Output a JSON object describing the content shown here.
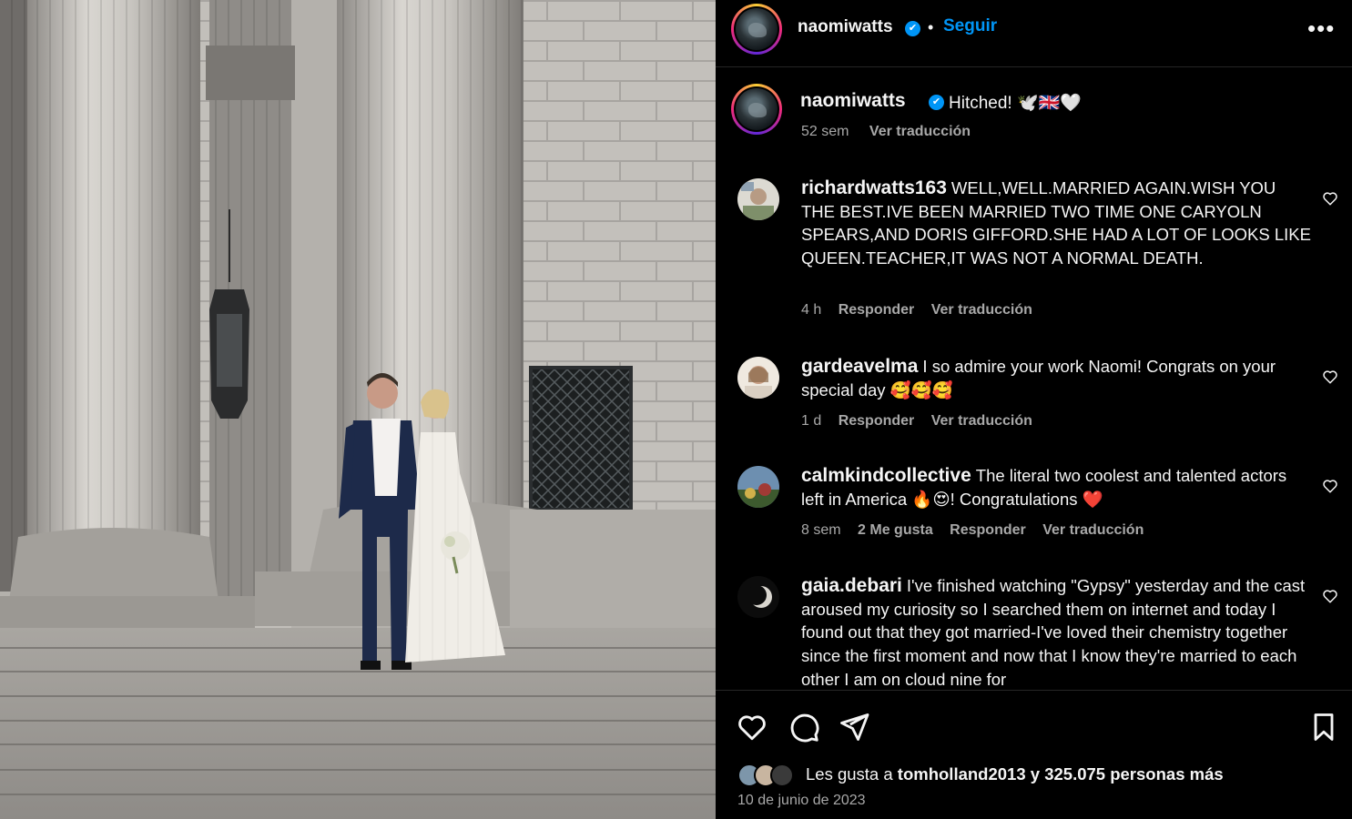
{
  "post": {
    "author": "naomiwatts",
    "verified_mark": "✔",
    "separator": "•",
    "follow_label": "Seguir",
    "more_label": "•••",
    "photo_alt": "photo",
    "caption_text": "Hitched! 🕊️🇬🇧🤍",
    "caption_age": "52 sem",
    "caption_translate": "Ver traducción"
  },
  "comments": [
    {
      "user": "richardwatts163",
      "text": "WELL,WELL.MARRIED AGAIN.WISH YOU THE BEST.IVE BEEN MARRIED TWO TIME ONE CARYOLN SPEARS,AND DORIS GIFFORD.SHE HAD A LOT OF LOOKS LIKE QUEEN.TEACHER,IT WAS NOT A NORMAL DEATH.",
      "age": "4 h",
      "likes": "",
      "reply": "Responder",
      "translate": "Ver traducción",
      "avatar_color": "#8a9a6e"
    },
    {
      "user": "gardeavelma",
      "text": "I so admire your work Naomi! Congrats on your special day 🥰🥰🥰",
      "age": "1 d",
      "likes": "",
      "reply": "Responder",
      "translate": "Ver traducción",
      "avatar_color": "#c9b7a2"
    },
    {
      "user": "calmkindcollective",
      "text": "The literal two coolest and talented actors left in America 🔥😍! Congratulations ❤️",
      "age": "8 sem",
      "likes": "2 Me gusta",
      "reply": "Responder",
      "translate": "Ver traducción",
      "avatar_color": "#4b6f8f"
    },
    {
      "user": "gaia.debari",
      "text": "I've finished watching \"Gypsy\" yesterday and the cast aroused my curiosity so I searched them on internet and today I found out that they got married-I've loved their chemistry together since the first moment and now that I know they're married to each other I am on cloud nine for",
      "age": "",
      "likes": "",
      "reply": "",
      "translate": "",
      "avatar_color": "#1a1a1a"
    }
  ],
  "actions": {
    "like_icon": "heart-icon",
    "comment_icon": "comment-icon",
    "share_icon": "send-icon",
    "save_icon": "bookmark-icon"
  },
  "likes": {
    "prefix": "Les gusta a",
    "user": "tomholland2013",
    "suffix": "y 325.075 personas más"
  },
  "date": "10 de junio de 2023",
  "colors": {
    "background": "#000000",
    "link_blue": "#0095f6",
    "muted": "#a8a8a8",
    "text": "#f5f5f5"
  }
}
